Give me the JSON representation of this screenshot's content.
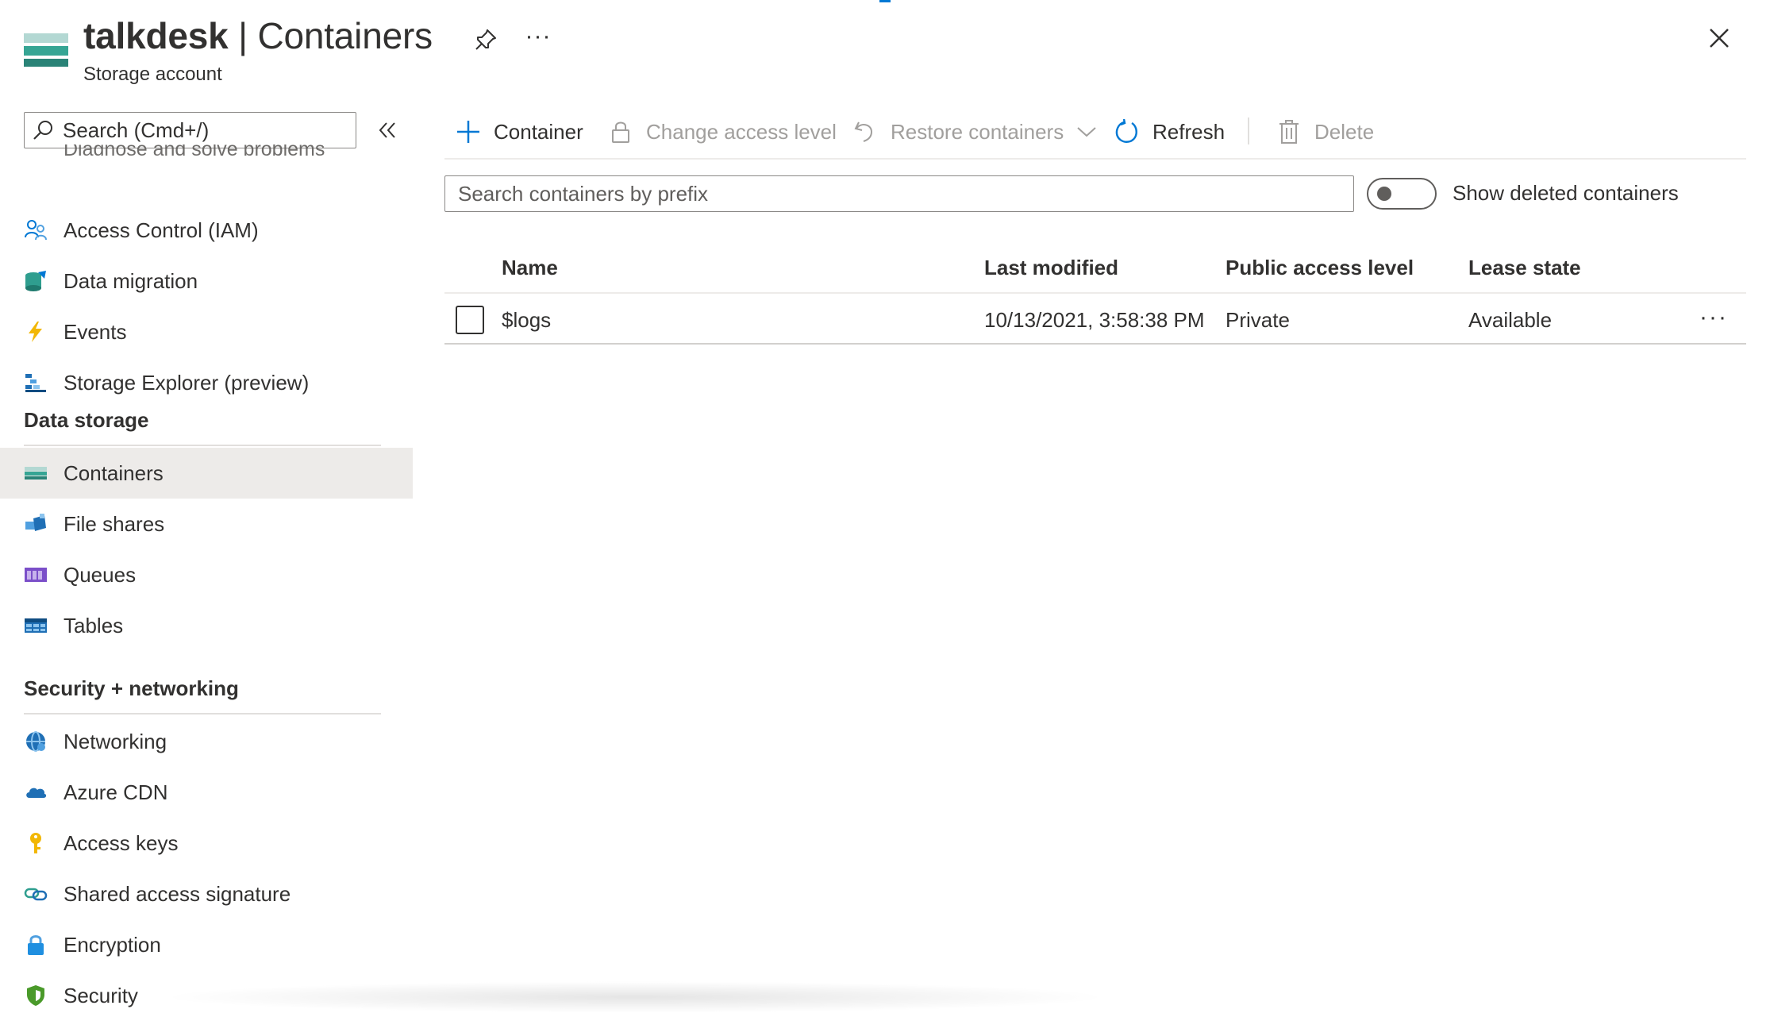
{
  "header": {
    "resource_name": "talkdesk",
    "separator": " | ",
    "page_name": "Containers",
    "subtitle": "Storage account",
    "more_label": "···"
  },
  "sidebar": {
    "search_placeholder": "Search (Cmd+/)",
    "clipped_item": "Diagnose and solve problems",
    "items_top": [
      {
        "label": "Access Control (IAM)",
        "icon": "people-icon"
      },
      {
        "label": "Data migration",
        "icon": "data-migration-icon"
      },
      {
        "label": "Events",
        "icon": "lightning-icon"
      },
      {
        "label": "Storage Explorer (preview)",
        "icon": "storage-explorer-icon"
      }
    ],
    "section_data_storage": "Data storage",
    "items_data_storage": [
      {
        "label": "Containers",
        "icon": "containers-icon"
      },
      {
        "label": "File shares",
        "icon": "file-shares-icon"
      },
      {
        "label": "Queues",
        "icon": "queues-icon"
      },
      {
        "label": "Tables",
        "icon": "tables-icon"
      }
    ],
    "section_security": "Security + networking",
    "items_security": [
      {
        "label": "Networking",
        "icon": "networking-icon"
      },
      {
        "label": "Azure CDN",
        "icon": "cloud-icon"
      },
      {
        "label": "Access keys",
        "icon": "key-icon"
      },
      {
        "label": "Shared access signature",
        "icon": "link-icon"
      },
      {
        "label": "Encryption",
        "icon": "lock-icon"
      },
      {
        "label": "Security",
        "icon": "shield-icon"
      }
    ]
  },
  "toolbar": {
    "add_container": "Container",
    "change_access": "Change access level",
    "restore": "Restore containers",
    "refresh": "Refresh",
    "delete": "Delete"
  },
  "filter": {
    "placeholder": "Search containers by prefix",
    "toggle_label": "Show deleted containers"
  },
  "table": {
    "columns": [
      "Name",
      "Last modified",
      "Public access level",
      "Lease state"
    ],
    "rows": [
      {
        "name": "$logs",
        "last_modified": "10/13/2021, 3:58:38 PM",
        "access": "Private",
        "lease": "Available"
      }
    ],
    "row_more": "···"
  },
  "colors": {
    "accent": "#0078d4",
    "selected_bg": "#edebe9",
    "disabled_text": "#a19f9d"
  }
}
